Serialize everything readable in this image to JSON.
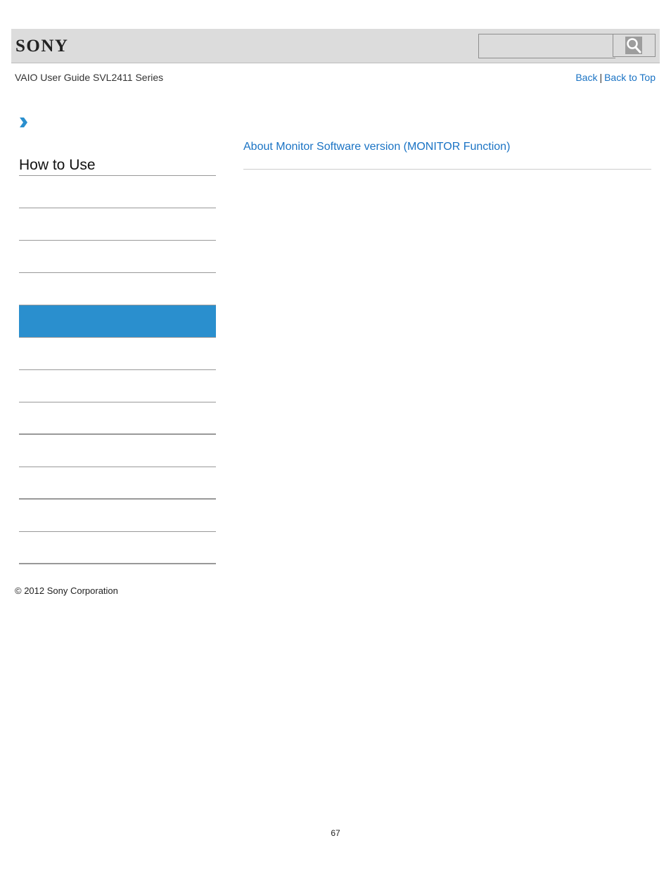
{
  "header": {
    "logo": "SONY",
    "search": {
      "value": "",
      "placeholder": ""
    },
    "search_icon": "magnifier-icon"
  },
  "subheader": {
    "guide_title": "VAIO User Guide SVL2411 Series",
    "links": {
      "back": "Back",
      "separator": "|",
      "back_to_top": "Back to Top"
    }
  },
  "breadcrumb": {
    "icon": "chevron-right-icon"
  },
  "sidebar": {
    "title": "How to Use",
    "items": [
      {
        "label": "",
        "active": false
      },
      {
        "label": "",
        "active": false
      },
      {
        "label": "",
        "active": false
      },
      {
        "label": "",
        "active": false
      },
      {
        "label": "",
        "active": true
      },
      {
        "label": "",
        "active": false
      },
      {
        "label": "",
        "active": false
      },
      {
        "label": "",
        "active": false
      },
      {
        "label": "",
        "active": false
      },
      {
        "label": "",
        "active": false
      },
      {
        "label": "",
        "active": false
      },
      {
        "label": "",
        "active": false
      }
    ]
  },
  "main": {
    "topic_link": "About Monitor Software version (MONITOR Function)"
  },
  "footer": {
    "copyright": "© 2012 Sony Corporation",
    "page_number": "67"
  },
  "colors": {
    "link": "#1a73c4",
    "active_item": "#2a8fce",
    "header_bg": "#dcdcdc"
  }
}
